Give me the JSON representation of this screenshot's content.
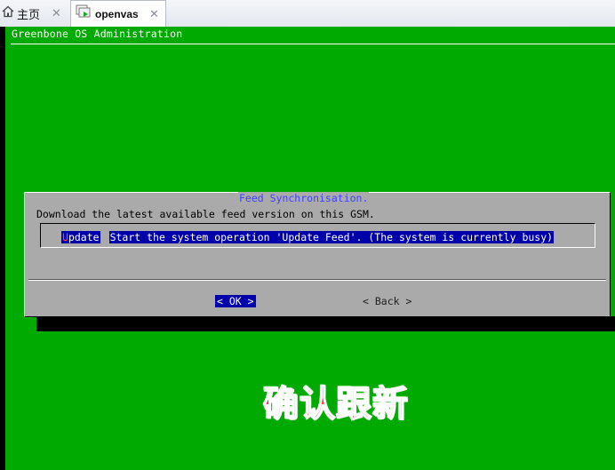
{
  "tabs": [
    {
      "label": "主页",
      "close": "✕"
    },
    {
      "label": "openvas",
      "close": "✕"
    }
  ],
  "screen": {
    "header_title": "Greenbone OS Administration"
  },
  "dialog": {
    "title": "Feed Synchronisation.",
    "description": "Download the latest available feed version on this GSM.",
    "menu_item": {
      "tag_hotkey": "U",
      "tag_rest": "pdate",
      "description": "Start the system operation 'Update Feed'. (The system is currently busy)"
    },
    "ok_label": "<  OK  >",
    "back_label": "< Back >"
  },
  "overlay": {
    "caption": "确认跟新"
  },
  "colors": {
    "console_bg": "#00aa00",
    "dialog_bg": "#aaaaaa",
    "highlight": "#0000aa",
    "title_blue": "#4040ff",
    "caption_red": "#ff2a2a"
  },
  "icons": {
    "home_tab": "home-icon",
    "vm_tab": "vm-icon"
  }
}
